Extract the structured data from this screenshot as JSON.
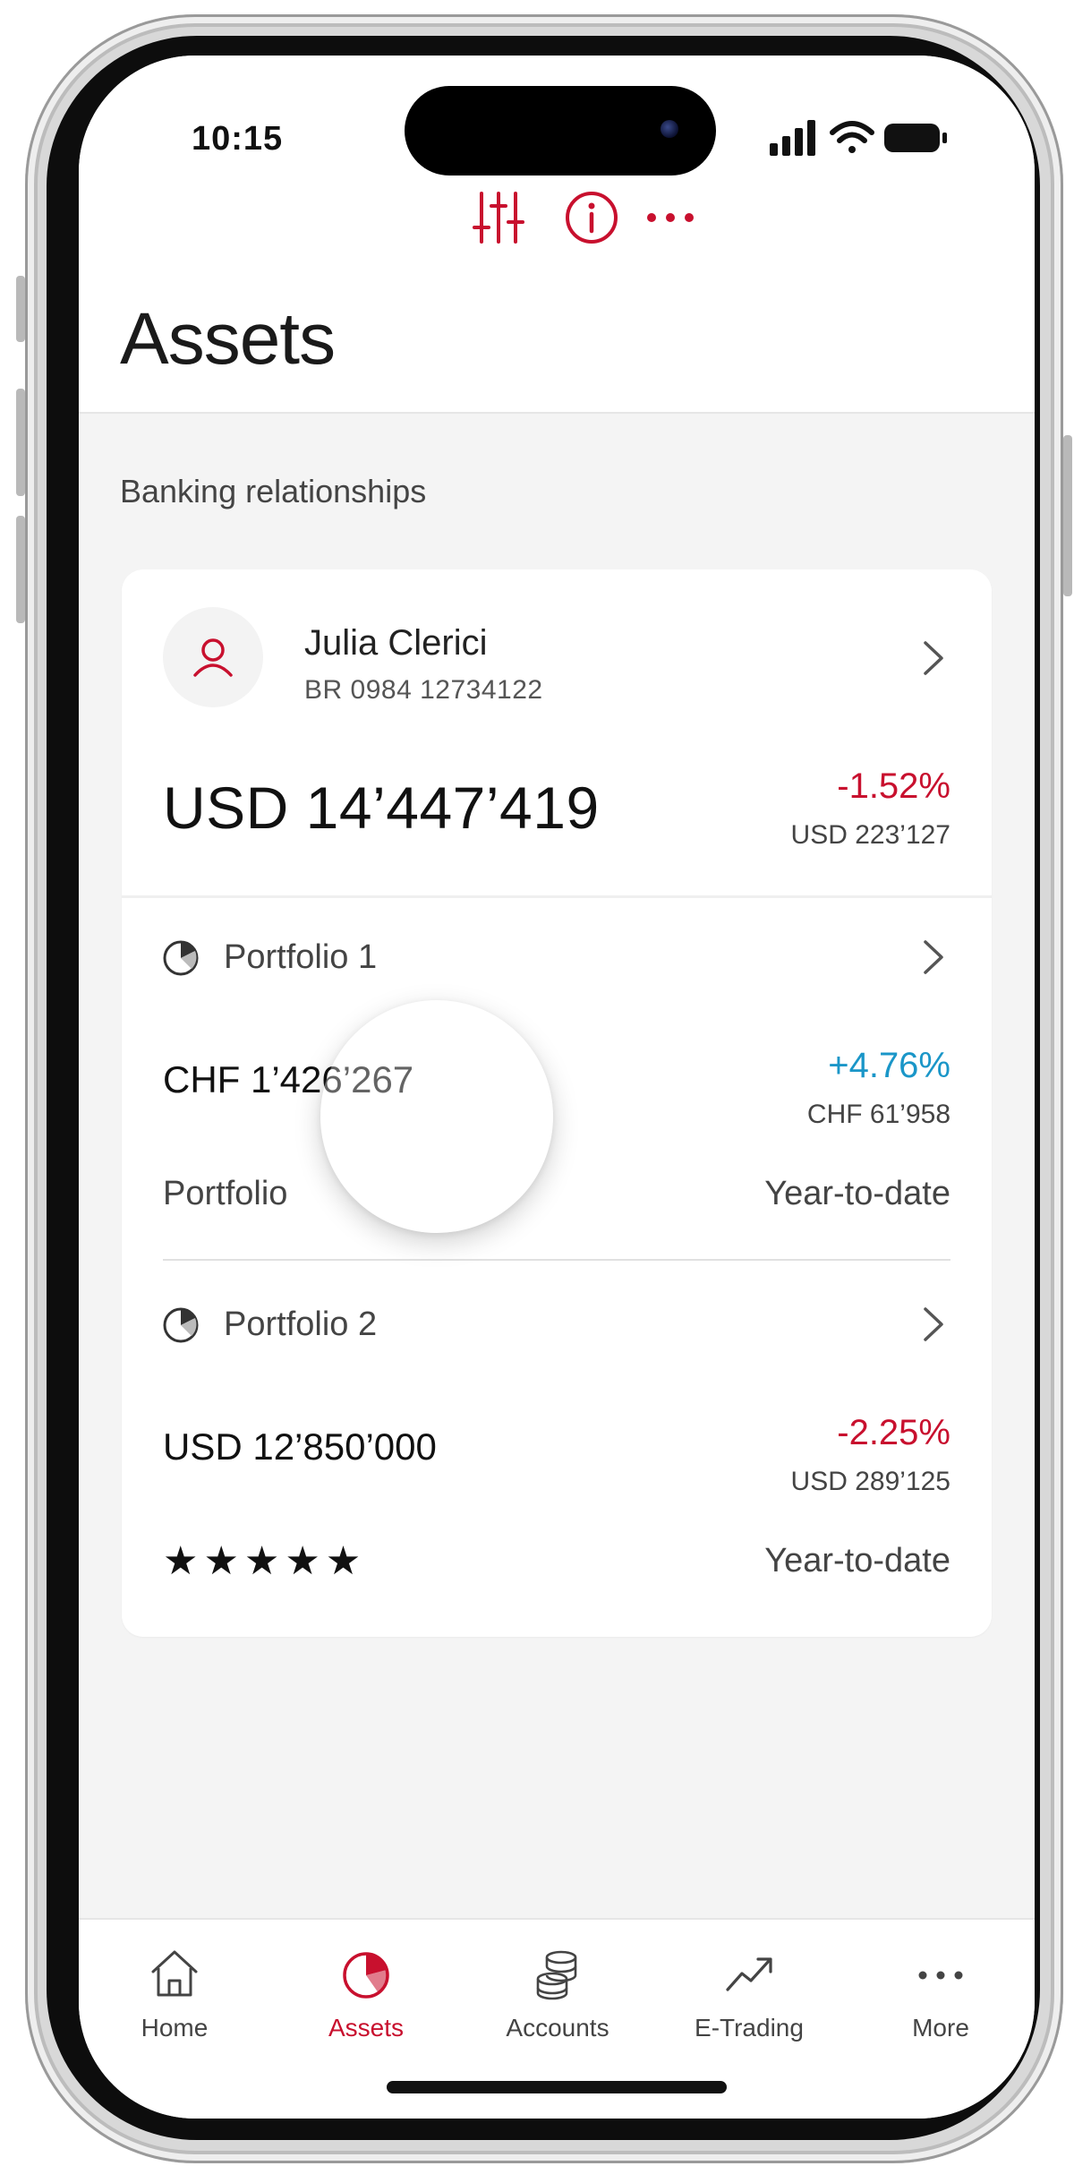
{
  "status_bar": {
    "time": "10:15"
  },
  "header": {
    "title": "Assets"
  },
  "section": {
    "label": "Banking relationships"
  },
  "relationship": {
    "name": "Julia Clerici",
    "id": "BR 0984 12734122",
    "total": "USD 14’447’419",
    "change_pct": "-1.52%",
    "change_abs": "USD 223’127"
  },
  "portfolios": [
    {
      "name": "Portfolio 1",
      "value": "CHF 1’426’267",
      "change_pct": "+4.76%",
      "change_abs": "CHF 61’958",
      "foot_left": "Portfolio",
      "foot_right": "Year-to-date"
    },
    {
      "name": "Portfolio 2",
      "value": "USD 12’850’000",
      "change_pct": "-2.25%",
      "change_abs": "USD 289’125",
      "rating": 5,
      "rating_display": "★★★★★",
      "foot_right": "Year-to-date"
    }
  ],
  "tabs": [
    {
      "label": "Home",
      "icon": "home-icon",
      "active": false
    },
    {
      "label": "Assets",
      "icon": "pie-chart-icon",
      "active": true
    },
    {
      "label": "Accounts",
      "icon": "coins-icon",
      "active": false
    },
    {
      "label": "E-Trading",
      "icon": "trend-up-icon",
      "active": false
    },
    {
      "label": "More",
      "icon": "more-dots-icon",
      "active": false
    }
  ],
  "colors": {
    "accent": "#c8102e",
    "positive": "#1a96c8",
    "negative": "#c8102e",
    "background": "#f4f4f4",
    "card": "#ffffff"
  }
}
